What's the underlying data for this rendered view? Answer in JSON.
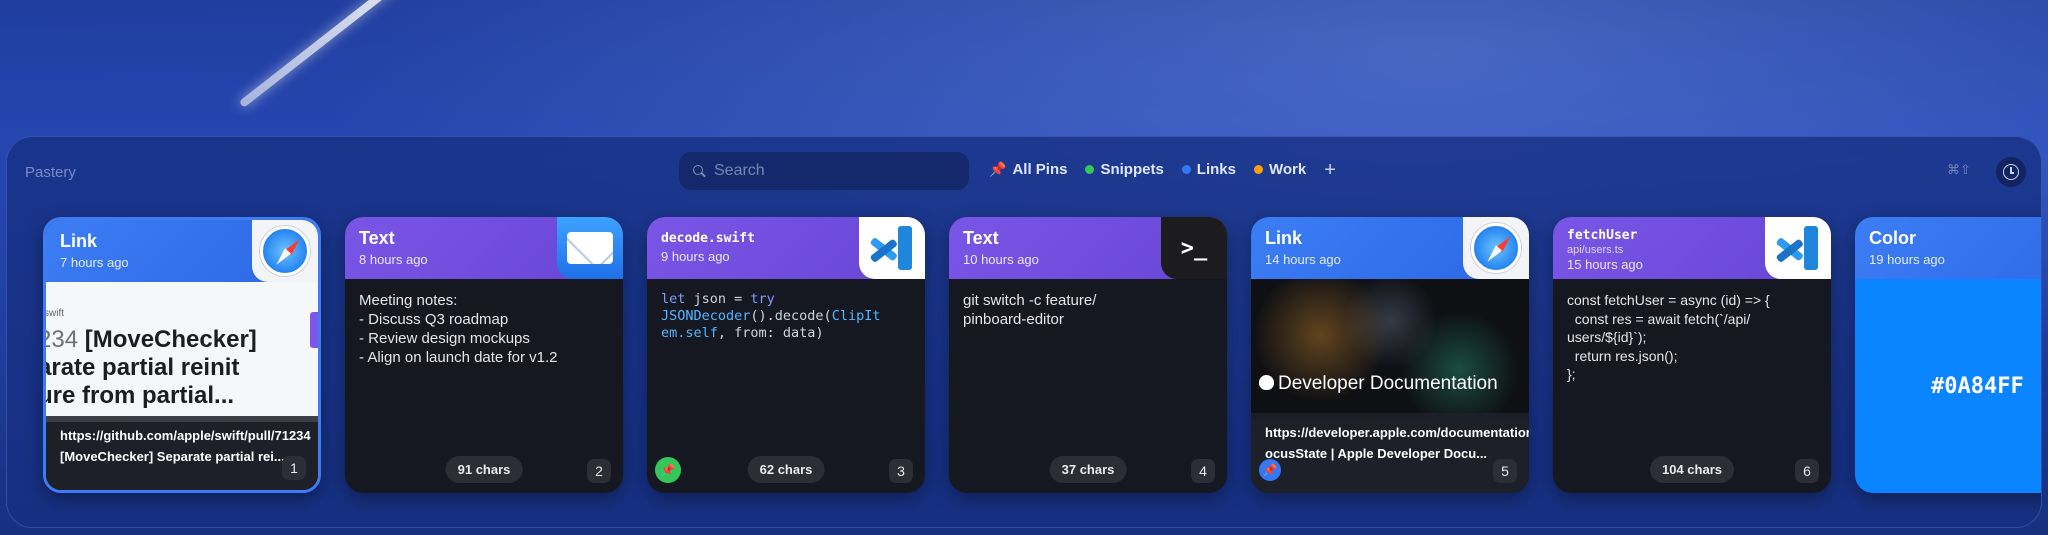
{
  "app": {
    "name": "Pastery"
  },
  "search": {
    "placeholder": "Search"
  },
  "filters": [
    {
      "label": "All Pins",
      "color": "#4c8dff",
      "icon": "pin-icon"
    },
    {
      "label": "Snippets",
      "color": "#34c759"
    },
    {
      "label": "Links",
      "color": "#3478f6"
    },
    {
      "label": "Work",
      "color": "#ff9f0a"
    }
  ],
  "toolbar": {
    "add_label": "+",
    "shortcut_label": "⌘⇧"
  },
  "cards": [
    {
      "type": "Link",
      "time": "7 hours ago",
      "app_icon": "safari-icon",
      "preview_small": "swift",
      "preview_num": "234",
      "preview_name": "[MoveChecker]",
      "preview_line2": "arate partial reinit",
      "preview_line3": "ure from partial...",
      "url": "https://github.com/apple/swift/pull/71234",
      "title": "[MoveChecker] Separate partial rei...",
      "index": "1",
      "selected": true
    },
    {
      "type": "Text",
      "time": "8 hours ago",
      "app_icon": "mail-icon",
      "content": "Meeting notes:\n- Discuss Q3 roadmap\n- Review design mockups\n- Align on launch date for v1.2",
      "chars": "91 chars",
      "index": "2"
    },
    {
      "type": "decode.swift",
      "time": "9 hours ago",
      "app_icon": "vscode-icon",
      "code": [
        "let",
        " json = ",
        "try",
        "JSONDecoder",
        "().decode(",
        "ClipIt",
        "em.self",
        ", from: data)"
      ],
      "chars": "62 chars",
      "index": "3",
      "pinned": true,
      "pin_color": "#34c759"
    },
    {
      "type": "Text",
      "time": "10 hours ago",
      "app_icon": "terminal-icon",
      "terminal_glyph": ">_",
      "content": "git switch -c feature/\npinboard-editor",
      "chars": "37 chars",
      "index": "4"
    },
    {
      "type": "Link",
      "time": "14 hours ago",
      "app_icon": "safari-icon",
      "preview_title": "Developer Documentation",
      "url": "https://developer.apple.com/documentation/swiftui/focusstate",
      "title": "ocusState | Apple Developer Docu...",
      "index": "5",
      "pinned": true,
      "pin_color": "#3478f6"
    },
    {
      "type": "fetchUser",
      "subtitle": "api/users.ts",
      "time": "15 hours ago",
      "app_icon": "vscode-icon",
      "content": "const fetchUser = async (id) => {\n  const res = await fetch(`/api/\nusers/${id}`);\n  return res.json();\n};",
      "chars": "104 chars",
      "index": "6"
    },
    {
      "type": "Color",
      "time": "19 hours ago",
      "hex": "#0A84FF",
      "swatch": "#0a84ff"
    }
  ]
}
